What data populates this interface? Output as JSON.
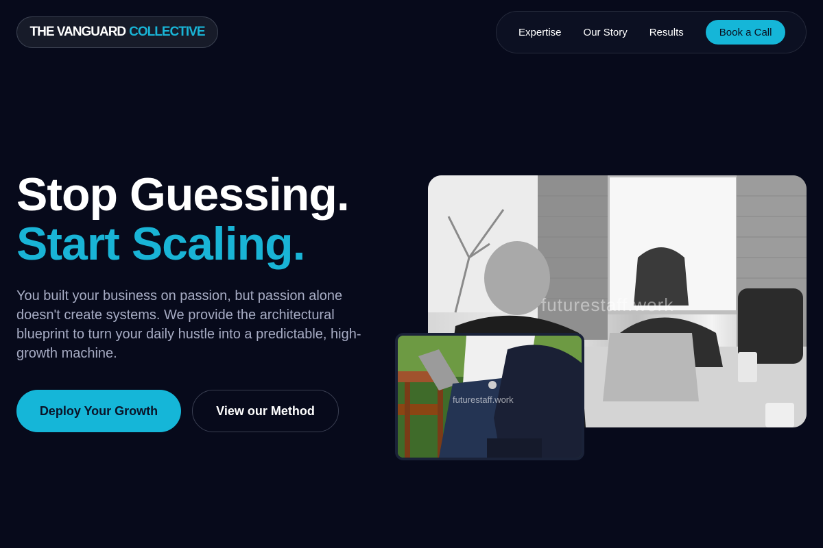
{
  "brand": {
    "name_part1": "THE VANGUARD",
    "name_part2": "COLLECTIVE"
  },
  "nav": {
    "items": [
      {
        "label": "Expertise"
      },
      {
        "label": "Our Story"
      },
      {
        "label": "Results"
      }
    ],
    "cta": "Book a Call"
  },
  "hero": {
    "headline_line1": "Stop Guessing.",
    "headline_line2": "Start Scaling.",
    "body": "You built your business on passion, but passion alone doesn't create systems. We provide the architectural blueprint to turn your daily hustle into a predictable, high-growth machine.",
    "primary_button": "Deploy Your Growth",
    "secondary_button": "View our Method"
  },
  "images": {
    "main_watermark": "futurestaff.work",
    "inset_watermark": "futurestaff.work"
  },
  "colors": {
    "background": "#070a1b",
    "accent": "#15b6d8",
    "muted_text": "#a7acc4"
  }
}
